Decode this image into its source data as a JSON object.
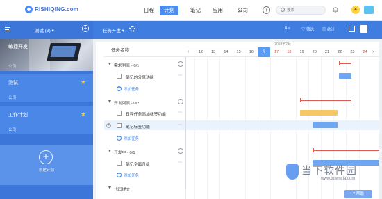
{
  "topbar": {
    "logo_text": "RISHIQING.com",
    "tabs": [
      {
        "label": "日程"
      },
      {
        "label": "计划"
      },
      {
        "label": "笔记"
      },
      {
        "label": "应用"
      },
      {
        "label": "公司"
      }
    ],
    "active_tab": "计划",
    "plus_label": "+",
    "search_placeholder": "搜索",
    "app_badge": "✕"
  },
  "sidebar": {
    "team_selector": "测试 (3) ▾",
    "add_label": "+",
    "projects": [
      {
        "title": "敏捷开发",
        "team": "公司",
        "starred": false
      },
      {
        "title": "测试",
        "team": "公司",
        "starred": true
      },
      {
        "title": "工作计划",
        "team": "公司",
        "starred": true
      }
    ],
    "new_project_label": "创建计划",
    "star_glyph": "★"
  },
  "toolbar": {
    "view_label": "任务开发 ▾",
    "tools": [
      {
        "label": "A ≡"
      },
      {
        "label": "▽ 筛选"
      },
      {
        "label": "▥ 统计"
      }
    ]
  },
  "tasks": {
    "column_header": "任务名称",
    "lists": [
      {
        "name": "需求列表 - 0/1",
        "tasks": [
          {
            "title": "笔记的分享功能"
          }
        ],
        "add_label": "添加任务"
      },
      {
        "name": "开发列表 - 0/2",
        "tasks": [
          {
            "title": "日程任务添加标签功能"
          },
          {
            "title": "笔记标签功能"
          }
        ],
        "add_label": "添加任务"
      },
      {
        "name": "开发中 - 0/1",
        "tasks": [
          {
            "title": "笔记全面升级"
          }
        ],
        "add_label": "添加任务"
      },
      {
        "name": "代码提交",
        "tasks": [],
        "add_label": ""
      }
    ],
    "more_glyph": "⋯"
  },
  "gantt": {
    "month_label": "2018年2月",
    "days": [
      {
        "label": "12",
        "weekend": false,
        "today": false
      },
      {
        "label": "13",
        "weekend": false,
        "today": false
      },
      {
        "label": "14",
        "weekend": false,
        "today": false
      },
      {
        "label": "15",
        "weekend": false,
        "today": false
      },
      {
        "label": "16",
        "weekend": false,
        "today": false
      },
      {
        "label": "今",
        "weekend": false,
        "today": true
      },
      {
        "label": "17",
        "weekend": true,
        "today": false
      },
      {
        "label": "18",
        "weekend": true,
        "today": false
      },
      {
        "label": "19",
        "weekend": false,
        "today": false
      },
      {
        "label": "20",
        "weekend": false,
        "today": false
      },
      {
        "label": "21",
        "weekend": false,
        "today": false
      },
      {
        "label": "22",
        "weekend": false,
        "today": false
      },
      {
        "label": "23",
        "weekend": false,
        "today": false
      },
      {
        "label": "24",
        "weekend": true,
        "today": false
      }
    ],
    "prev_label": "‹",
    "next_label": "›",
    "colors": {
      "bar_blue": "#6fa6f2",
      "bar_orange": "#f5c765",
      "span_red": "#e05a54",
      "today": "#5a9bf5"
    }
  },
  "watermark": {
    "text": "当下软件园",
    "domain": "www.downxia.com"
  },
  "help": {
    "label": "? 帮助"
  }
}
